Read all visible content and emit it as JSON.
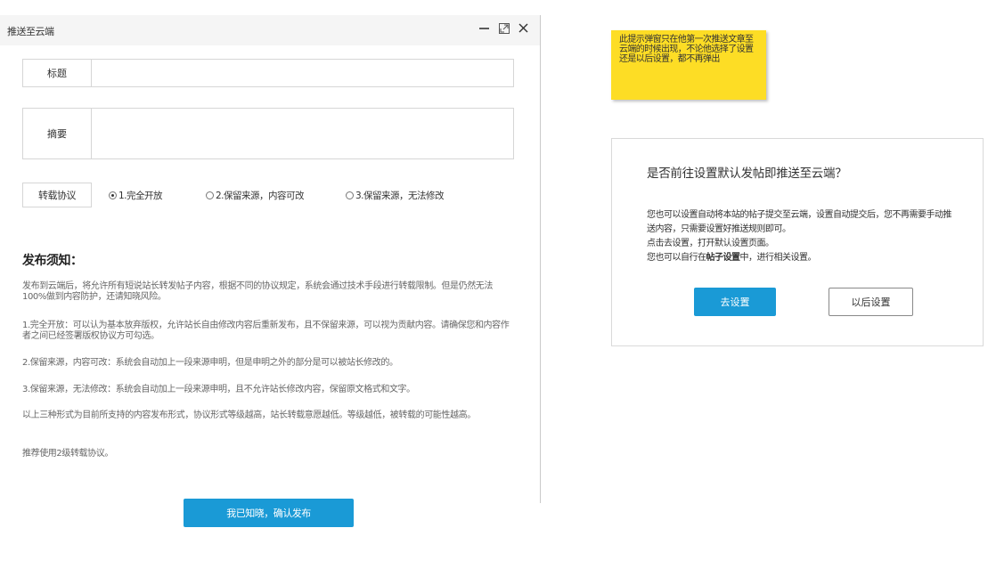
{
  "dialog": {
    "title": "推送至云端",
    "controls": {
      "minimize": "minimize-icon",
      "maximize": "maximize-icon",
      "close": "close-icon"
    },
    "fields": {
      "title_label": "标题",
      "title_value": "",
      "summary_label": "摘要",
      "summary_value": ""
    },
    "protocol": {
      "label": "转载协议",
      "selected": 0,
      "options": [
        "1.完全开放",
        "2.保留来源，内容可改",
        "3.保留来源，无法修改"
      ]
    },
    "notice": {
      "heading": "发布须知：",
      "paragraphs": [
        "发布到云端后，将允许所有短说站长转发帖子内容，根据不同的协议规定，系统会通过技术手段进行转载限制。但是仍然无法100%做到内容防护，还请知晓风险。",
        "1.完全开放：可以认为基本放弃版权，允许站长自由修改内容后重新发布，且不保留来源，可以视为贡献内容。请确保您和内容作者之间已经签署版权协议方可勾选。",
        "2.保留来源，内容可改：系统会自动加上一段来源申明，但是申明之外的部分是可以被站长修改的。",
        "3.保留来源，无法修改：系统会自动加上一段来源申明，且不允许站长修改内容，保留原文格式和文字。",
        "以上三种形式为目前所支持的内容发布形式，协议形式等级越高，站长转载意愿越低。等级越低，被转载的可能性越高。",
        "推荐使用2级转载协议。"
      ]
    },
    "confirm_button": "我已知晓，确认发布"
  },
  "sticky_note": {
    "text": "此提示弹窗只在他第一次推送文章至云端的时候出现，不论他选择了设置还是以后设置，都不再弹出"
  },
  "prompt": {
    "title": "是否前往设置默认发帖即推送至云端？",
    "line1": "您也可以设置自动将本站的帖子提交至云端，设置自动提交后，您不再需要手动推送内容，只需要设置好推送规则即可。",
    "line2": "点击去设置，打开默认设置页面。",
    "line3_prefix": "您也可以自行在",
    "line3_bold": "帖子设置",
    "line3_suffix": "中，进行相关设置。",
    "go_button": "去设置",
    "later_button": "以后设置"
  },
  "colors": {
    "primary": "#1a9ad6",
    "sticky": "#fddd25"
  }
}
